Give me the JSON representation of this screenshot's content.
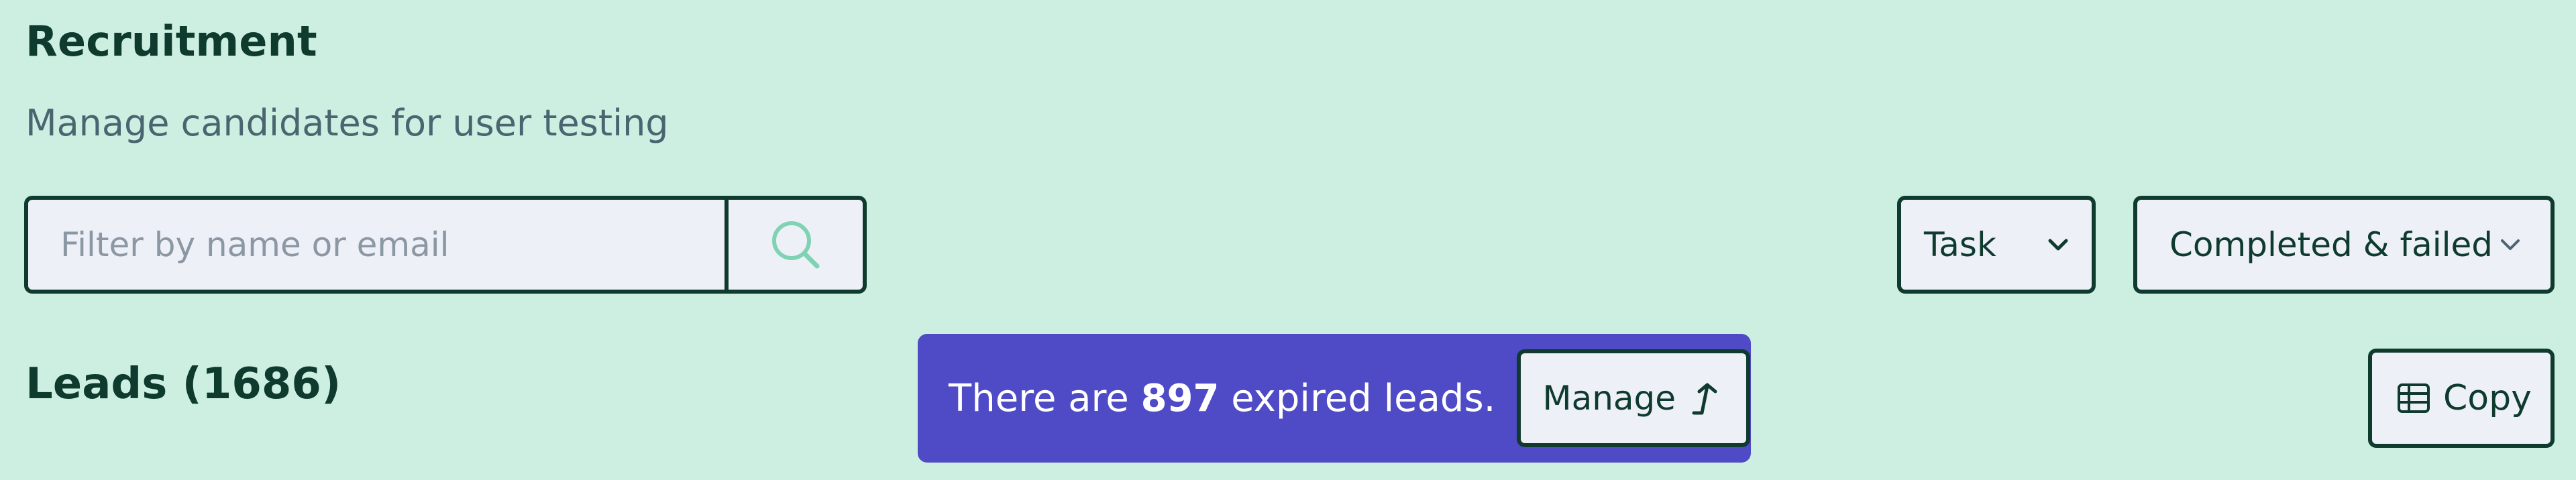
{
  "header": {
    "title": "Recruitment",
    "subtitle": "Manage candidates for user testing"
  },
  "search": {
    "placeholder": "Filter by name or email",
    "value": "",
    "button_icon": "search-icon"
  },
  "filters": {
    "task": {
      "label": "Task",
      "icon": "chevron-down-icon"
    },
    "status": {
      "label": "Completed & failed",
      "icon": "chevron-down-icon"
    }
  },
  "leads": {
    "heading": "Leads (1686)"
  },
  "banner": {
    "prefix": "There are ",
    "count": "897",
    "suffix": " expired leads.",
    "manage_label": "Manage",
    "manage_icon": "arrow-turn-up-icon"
  },
  "actions": {
    "copy_label": "Copy",
    "copy_icon": "table-icon"
  },
  "colors": {
    "background": "#ccefe1",
    "primary_text": "#0f3b2e",
    "banner_bg": "#4f4ac6",
    "control_bg": "#eef0f8",
    "search_icon": "#7fd3b3"
  }
}
